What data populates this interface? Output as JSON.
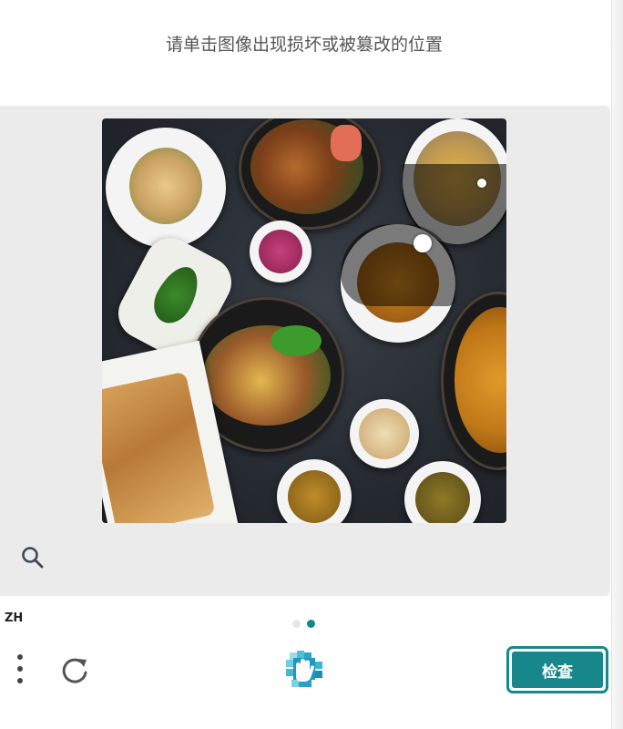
{
  "prompt": "请单击图像出现损坏或被篡改的位置",
  "language": "ZH",
  "submit_label": "检查",
  "pager": {
    "count": 2,
    "active": 2
  },
  "icons": {
    "search": "search-icon",
    "menu": "vertical-dots-icon",
    "refresh": "refresh-icon",
    "logo": "hand-logo-icon"
  },
  "colors": {
    "accent": "#17878b",
    "panel": "#ebebeb",
    "pager_inactive": "#e6e6e6"
  },
  "image": {
    "description_kind": "food-table-photo-with-altered-region"
  }
}
